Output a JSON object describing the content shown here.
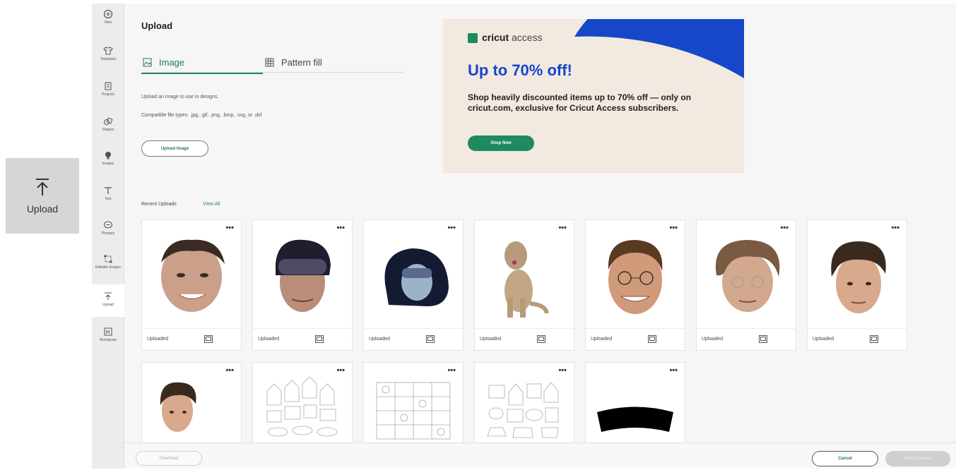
{
  "callout": {
    "label": "Upload",
    "icon": "upload-icon"
  },
  "rail": [
    {
      "label": "New",
      "icon": "plus-circle-icon"
    },
    {
      "label": "Templates",
      "icon": "shirt-icon"
    },
    {
      "label": "Projects",
      "icon": "projects-icon"
    },
    {
      "label": "Shapes",
      "icon": "shapes-icon"
    },
    {
      "label": "Images",
      "icon": "lightbulb-icon"
    },
    {
      "label": "Text",
      "icon": "text-icon"
    },
    {
      "label": "Phrases",
      "icon": "chat-icon"
    },
    {
      "label": "Editable Images",
      "icon": "editable-images-icon"
    },
    {
      "label": "Upload",
      "icon": "upload-icon"
    },
    {
      "label": "Monogram",
      "icon": "monogram-icon"
    }
  ],
  "panel": {
    "title": "Upload",
    "tabs": [
      {
        "label": "Image",
        "icon": "image-icon",
        "active": true
      },
      {
        "label": "Pattern fill",
        "icon": "pattern-icon",
        "active": false
      }
    ],
    "description": "Upload an image to use in designs.",
    "compatible": "Compatible file types: .jpg, .gif, .png, .bmp, .svg, or .dxf",
    "upload_button": "Upload Image",
    "recent_label": "Recent Uploads",
    "view_all": "View All"
  },
  "promo": {
    "logo_bold": "cricut",
    "logo_thin": "access",
    "headline": "Up to 70% off!",
    "body": "Shop heavily discounted items up to 70% off — only on cricut.com, exclusive for Cricut Access subscribers.",
    "cta": "Shop Now",
    "colors": {
      "blue": "#1647c9",
      "green": "#1f8a60",
      "cream": "#f2e9e0"
    }
  },
  "uploads": [
    {
      "caption": "Uploaded",
      "kind": "woman-face"
    },
    {
      "caption": "Uploaded",
      "kind": "goggles-face"
    },
    {
      "caption": "Uploaded",
      "kind": "hood-face"
    },
    {
      "caption": "Uploaded",
      "kind": "dog"
    },
    {
      "caption": "Uploaded",
      "kind": "man-face"
    },
    {
      "caption": "Uploaded",
      "kind": "curly-face"
    },
    {
      "caption": "Uploaded",
      "kind": "boy-face"
    },
    {
      "caption": "",
      "kind": "boy-face-small"
    },
    {
      "caption": "",
      "kind": "pattern-sketch"
    },
    {
      "caption": "",
      "kind": "pattern-grid"
    },
    {
      "caption": "",
      "kind": "pattern-sketch-2"
    },
    {
      "caption": "",
      "kind": "black-arc"
    }
  ],
  "menu_glyph": "•••",
  "footer": {
    "download": "Download",
    "cancel": "Cancel",
    "add": "Add to Canvas"
  }
}
